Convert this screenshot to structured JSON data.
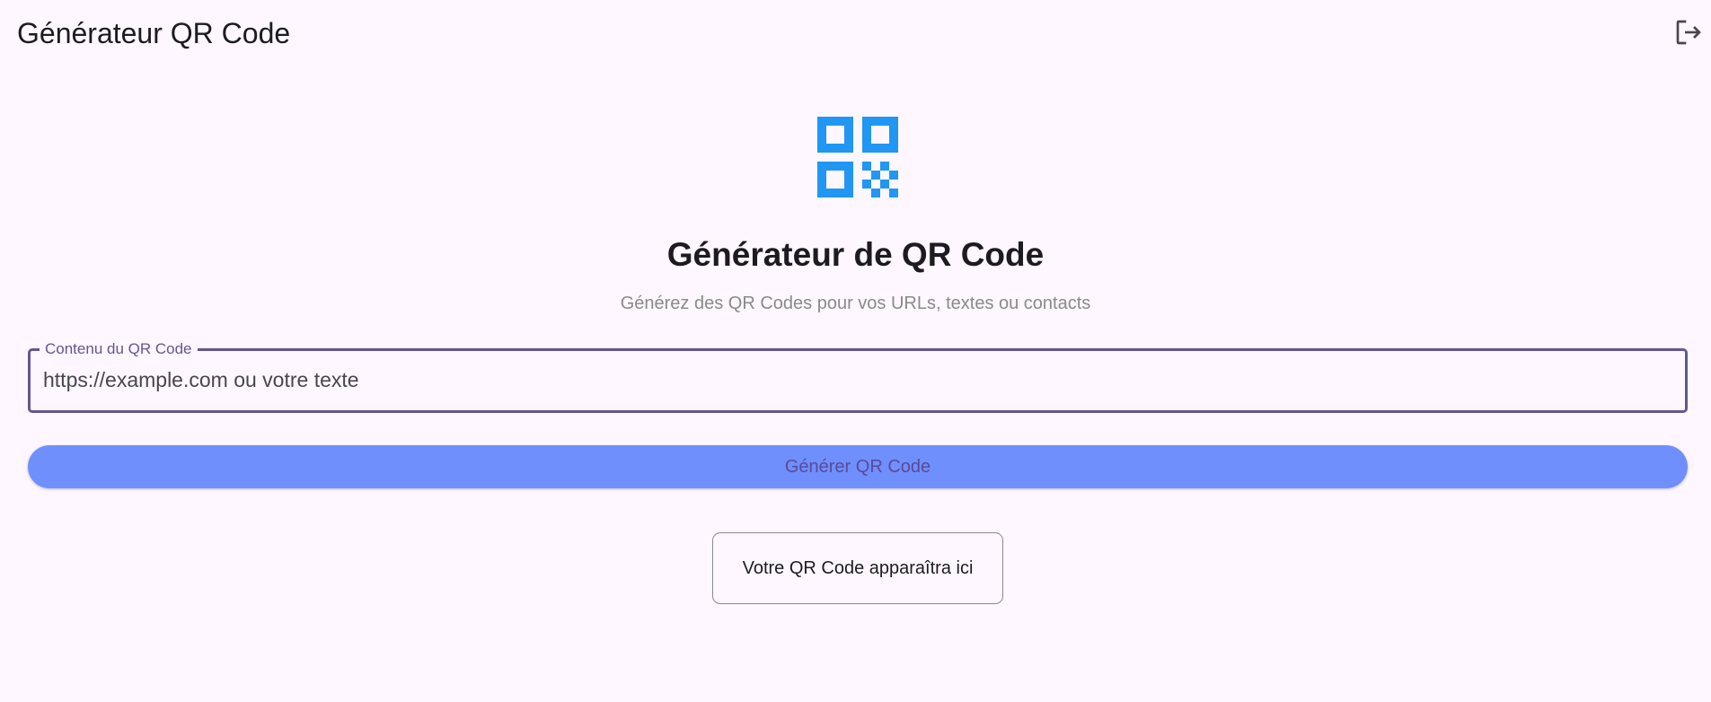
{
  "appbar": {
    "title": "Générateur QR Code",
    "logout_icon": "logout-icon"
  },
  "hero": {
    "icon": "qr-code-icon",
    "icon_color": "#2196f3",
    "title": "Générateur de QR Code",
    "subtitle": "Générez des QR Codes pour vos URLs, textes ou contacts"
  },
  "form": {
    "field_label": "Contenu du QR Code",
    "field_placeholder": "https://example.com ou votre texte",
    "field_value": "",
    "generate_label": "Générer QR Code"
  },
  "result": {
    "placeholder_text": "Votre QR Code apparaîtra ici"
  },
  "colors": {
    "background": "#fef7ff",
    "accent": "#65558f",
    "button": "#6f8ffc"
  }
}
